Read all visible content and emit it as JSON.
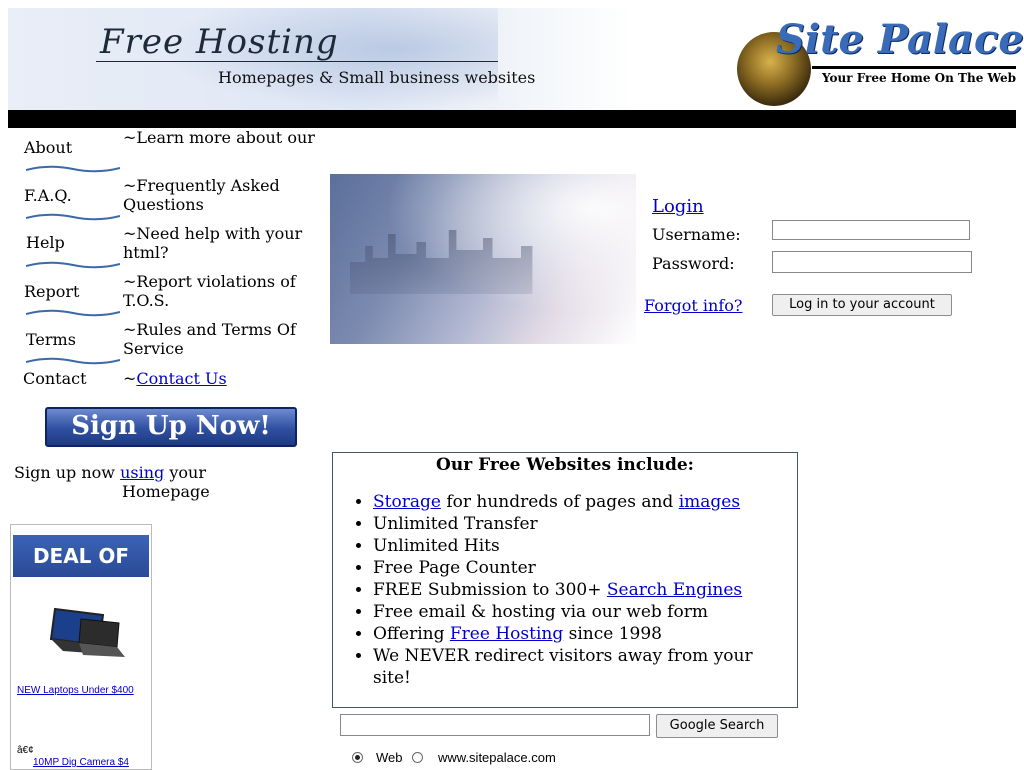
{
  "header": {
    "brand_title": "Free Hosting",
    "tagline": "Homepages & Small business websites",
    "logo_title": "Site Palace",
    "logo_tagline": "Your Free Home On The Web"
  },
  "sidebar": {
    "items": [
      {
        "label": "About",
        "description": "~Learn more about our"
      },
      {
        "label": "F.A.Q.",
        "description": "~Frequently Asked Questions"
      },
      {
        "label": "Help",
        "description": "~Need help with your html?"
      },
      {
        "label": "Report",
        "description": "~Report violations of T.O.S."
      },
      {
        "label": "Terms",
        "description": "~Rules and Terms Of Service"
      },
      {
        "label": "Contact",
        "description_prefix": "~",
        "description_link": "Contact Us"
      }
    ],
    "signup_button": "Sign Up Now!",
    "signup_text": "Sign up now",
    "signup_link": "using",
    "signup_text2": "your",
    "signup_text3": "Homepage"
  },
  "ad": {
    "deal_label": "DEAL OF THE DAY!",
    "link1": "NEW Laptops Under $400",
    "text1": "â€¢",
    "link2": "10MP Dig Camera $4"
  },
  "login": {
    "heading": "Login",
    "username_label": "Username:",
    "password_label": "Password:",
    "forgot_link": "Forgot info?",
    "submit_label": "Log in to your account"
  },
  "features": {
    "title": "Our Free Websites include:",
    "items": [
      {
        "link": "Storage",
        "text": " for hundreds of pages and ",
        "link2": "images"
      },
      {
        "text": "Unlimited Transfer"
      },
      {
        "text": "Unlimited Hits"
      },
      {
        "text": "Free Page Counter"
      },
      {
        "text": "FREE Submission to 300+ ",
        "link": "Search Engines"
      },
      {
        "text": "Free email & hosting via our web form"
      },
      {
        "text": "Offering ",
        "link": "Free Hosting",
        "text2": " since 1998"
      },
      {
        "text": "We NEVER redirect visitors away from your site!"
      }
    ]
  },
  "search": {
    "field_value": "",
    "button_label": "Google Search",
    "option_web": "Web",
    "option_site": "www.sitepalace.com"
  },
  "colors": {
    "link": "#0000cc",
    "header_bar": "#000000",
    "logo_blue": "#3a6bb8"
  }
}
